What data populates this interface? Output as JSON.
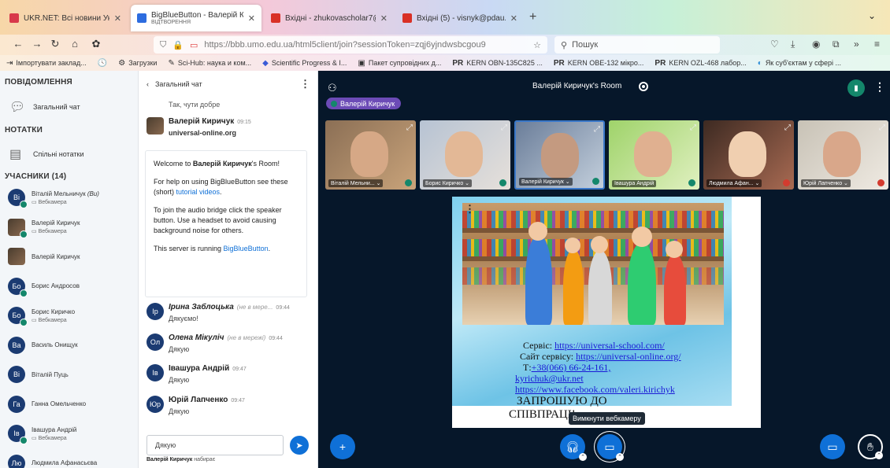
{
  "browser": {
    "tabs": [
      {
        "title": "UKR.NET: Всі новини України,",
        "close": "✕",
        "color": "#d8394a"
      },
      {
        "title": "BigBlueButton - Валерій Кирич",
        "subtitle": "ВІДТВОРЕННЯ",
        "close": "✕",
        "color": "#2d6cdf"
      },
      {
        "title": "Вхідні - zhukovascholar7@gma",
        "close": "✕",
        "color": "#d93025"
      },
      {
        "title": "Вхідні (5) - visnyk@pdau.edu.u",
        "close": "✕",
        "color": "#d93025"
      }
    ],
    "new_tab": "+",
    "url": "https://bbb.umo.edu.ua/html5client/join?sessionToken=zqj6yjndwsbcgou9",
    "search_placeholder": "Пошук",
    "bookmarks": [
      {
        "icon": "⇥",
        "label": "Імпортувати заклад..."
      },
      {
        "icon": "🕓",
        "label": ""
      },
      {
        "icon": "⚙",
        "label": "Загрузки"
      },
      {
        "icon": "✎",
        "label": "Sci-Hub: наука и ком..."
      },
      {
        "icon": "◆",
        "label": "Scientific Progress & I..."
      },
      {
        "icon": "▣",
        "label": "Пакет супровідних д..."
      },
      {
        "icon": "PR",
        "label": "KERN OBN-135C825 ..."
      },
      {
        "icon": "PR",
        "label": "KERN OBE-132 мікро..."
      },
      {
        "icon": "PR",
        "label": "KERN OZL-468 лабор..."
      },
      {
        "icon": "◐",
        "label": "Як суб'єктам у сфері ..."
      }
    ]
  },
  "left_panel": {
    "messages_title": "ПОВІДОМЛЕННЯ",
    "public_chat": "Загальний чат",
    "notes_title": "НОТАТКИ",
    "shared_notes": "Спільні нотатки",
    "participants_title": "УЧАСНИКИ (14)",
    "users": [
      {
        "initials": "Ві",
        "name": "Віталій Мельничук",
        "you": "(Ви)",
        "status": "Вебкамера",
        "photo": false
      },
      {
        "initials": "",
        "name": "Валерій Киричук",
        "you": "",
        "status": "Вебкамера",
        "photo": true
      },
      {
        "initials": "",
        "name": "Валерій Киричук",
        "you": "",
        "status": "",
        "photo": true
      },
      {
        "initials": "Бо",
        "name": "Борис Андросов",
        "you": "",
        "status": "",
        "photo": false
      },
      {
        "initials": "Бо",
        "name": "Борис Киричко",
        "you": "",
        "status": "Вебкамера",
        "photo": false
      },
      {
        "initials": "Ва",
        "name": "Василь Онищук",
        "you": "",
        "status": "",
        "photo": false
      },
      {
        "initials": "Ві",
        "name": "Віталій Пуць",
        "you": "",
        "status": "",
        "photo": false
      },
      {
        "initials": "Га",
        "name": "Ганна Омельченко",
        "you": "",
        "status": "",
        "photo": false
      },
      {
        "initials": "Ів",
        "name": "Івашура Андрій",
        "you": "",
        "status": "Вебкамера",
        "photo": false
      },
      {
        "initials": "Лю",
        "name": "Людмила Афанасьєва",
        "you": "",
        "status": "",
        "photo": false
      }
    ]
  },
  "chat": {
    "title": "Загальний чат",
    "prev_text": "Так, чути добре",
    "first_msg": {
      "name": "Валерій Киричук",
      "time": "09:15",
      "text": "universal-online.org"
    },
    "welcome": {
      "p1a": "Welcome to ",
      "p1b": "Валерій Киричук",
      "p1c": "'s Room!",
      "p2a": "For help on using BigBlueButton see these (short) ",
      "p2link": "tutorial videos",
      "p2b": ".",
      "p3": "To join the audio bridge click the speaker button. Use a headset to avoid causing background noise for others.",
      "p4a": "This server is running ",
      "p4link": "BigBlueButton",
      "p4b": "."
    },
    "messages": [
      {
        "initials": "Ір",
        "name": "Ірина Заблоцька",
        "offline": "(не в мере...",
        "time": "09:44",
        "text": "Дякуємо!",
        "italic": true
      },
      {
        "initials": "Ол",
        "name": "Олена Мікуліч",
        "offline": "(не в мережі)",
        "time": "09:44",
        "text": "Дякую",
        "italic": true
      },
      {
        "initials": "Ів",
        "name": "Івашура Андрій",
        "offline": "",
        "time": "09:47",
        "text": "Дякую",
        "italic": false
      },
      {
        "initials": "Юр",
        "name": "Юрій Лапченко",
        "offline": "",
        "time": "09:47",
        "text": "Дякую",
        "italic": false
      }
    ],
    "input_value": "Дякую",
    "typing_name": "Валерій Киричук",
    "typing_text": " набирає"
  },
  "main": {
    "room_title": "Валерій Киричук's Room",
    "talking_user": "Валерій Киричук",
    "videos": [
      {
        "label": "Віталій Мельни... ⌄",
        "muted": false
      },
      {
        "label": "Борис Киричко ⌄",
        "muted": false
      },
      {
        "label": "Валерій Киричук ⌄",
        "muted": false
      },
      {
        "label": "Івашура Андрій",
        "muted": false
      },
      {
        "label": "Людмила Афан... ⌄",
        "muted": true
      },
      {
        "label": "Юрій Лапченко ⌄",
        "muted": true
      }
    ],
    "slide": {
      "line1_label": "Сервіс: ",
      "line1_link": "https://universal-school.com/",
      "line2_label": "Сайт сервісу: ",
      "line2_link": "https://universal-online.org/",
      "line3_label": "Т:",
      "line3_link": "+38(066) 66-24-161,",
      "line4_link": "kyrichuk@ukr.net",
      "line5_link": "https://www.facebook.com/valeri.kirichyk",
      "cta1": "ЗАПРОШУЮ ДО",
      "cta2": "СПІВПРАЦІ!"
    },
    "tooltip": "Вимкнути вебкамеру"
  },
  "colors": {
    "accent": "#0f70d7",
    "main_bg": "#06172a",
    "mic_green": "#14876b",
    "avatar_blue": "#1b3b72",
    "talking_purple": "#6c4bb6"
  }
}
